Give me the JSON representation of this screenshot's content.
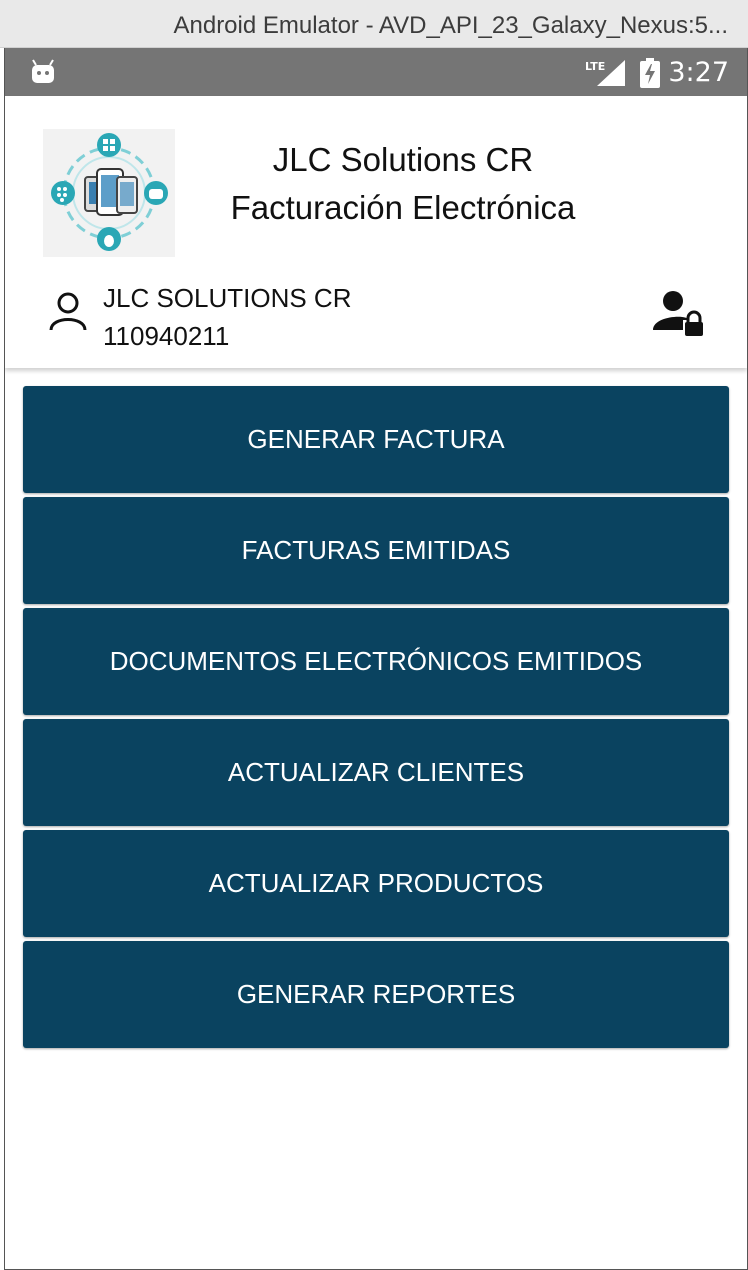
{
  "window": {
    "title": "Android Emulator - AVD_API_23_Galaxy_Nexus:5..."
  },
  "status_bar": {
    "time": "3:27",
    "network": "LTE",
    "icons": [
      "android-icon",
      "lte-signal-icon",
      "battery-charging-icon"
    ]
  },
  "header": {
    "title_line1": "JLC Solutions CR",
    "title_line2": "Facturación Electrónica",
    "logo_icon": "devices-logo-icon",
    "user_name": "JLC SOLUTIONS CR",
    "user_id": "110940211",
    "user_icon": "user-icon",
    "lock_icon": "user-lock-icon"
  },
  "menu": {
    "items": [
      {
        "label": "GENERAR FACTURA"
      },
      {
        "label": "FACTURAS EMITIDAS"
      },
      {
        "label": "DOCUMENTOS ELECTRÓNICOS EMITIDOS"
      },
      {
        "label": "ACTUALIZAR CLIENTES"
      },
      {
        "label": "ACTUALIZAR PRODUCTOS"
      },
      {
        "label": "GENERAR REPORTES"
      }
    ]
  },
  "colors": {
    "button_bg": "#0a4360",
    "status_bar": "#757575",
    "logo_accent": "#2aa7b5"
  }
}
